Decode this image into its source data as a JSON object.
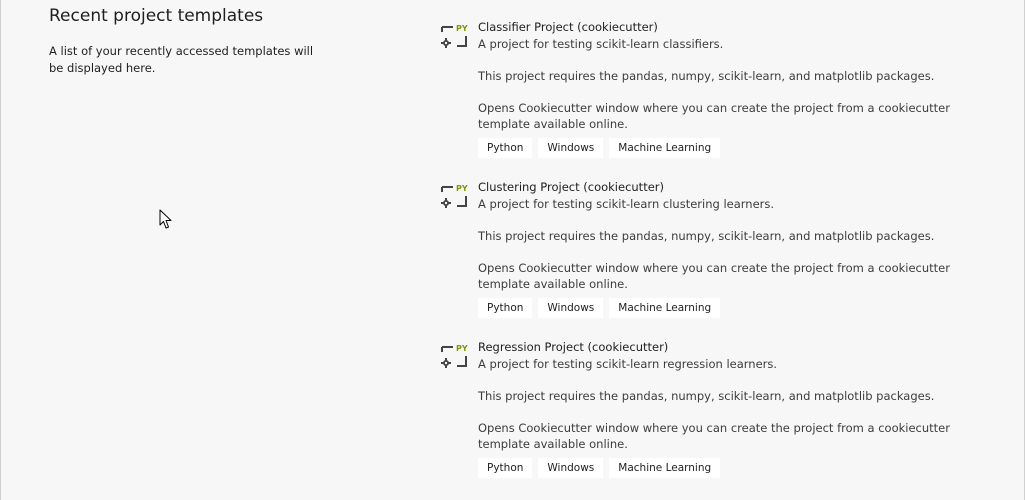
{
  "recent": {
    "title": "Recent project templates",
    "description": "A list of your recently accessed templates will be displayed here."
  },
  "colors": {
    "accent_py": "#7a9a00",
    "icon_gray": "#444444"
  },
  "templates": [
    {
      "title": "Classifier Project (cookiecutter)",
      "summary": "A project for testing scikit-learn classifiers.",
      "requires": "This project requires the pandas, numpy, scikit-learn, and matplotlib packages.",
      "opens": "Opens Cookiecutter window where you can create the project from a cookiecutter template available online.",
      "icon": "python-project-icon",
      "icon_text": "PY",
      "tags": [
        "Python",
        "Windows",
        "Machine Learning"
      ]
    },
    {
      "title": "Clustering Project (cookiecutter)",
      "summary": "A project for testing scikit-learn clustering learners.",
      "requires": "This project requires the pandas, numpy, scikit-learn, and matplotlib packages.",
      "opens": "Opens Cookiecutter window where you can create the project from a cookiecutter template available online.",
      "icon": "python-project-icon",
      "icon_text": "PY",
      "tags": [
        "Python",
        "Windows",
        "Machine Learning"
      ]
    },
    {
      "title": "Regression Project (cookiecutter)",
      "summary": "A project for testing scikit-learn regression learners.",
      "requires": "This project requires the pandas, numpy, scikit-learn, and matplotlib packages.",
      "opens": "Opens Cookiecutter window where you can create the project from a cookiecutter template available online.",
      "icon": "python-project-icon",
      "icon_text": "PY",
      "tags": [
        "Python",
        "Windows",
        "Machine Learning"
      ]
    }
  ]
}
